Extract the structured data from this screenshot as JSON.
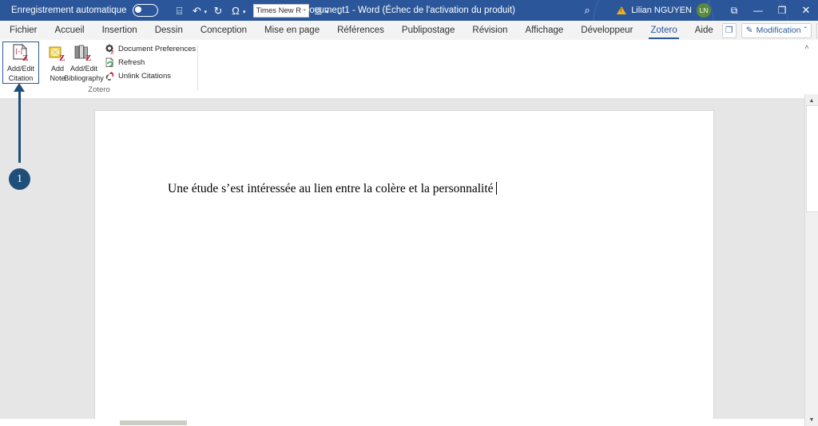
{
  "titlebar": {
    "autosave_label": "Enregistrement automatique",
    "autosave_state": "off",
    "document_title": "Document1  -  Word (Échec de l'activation du produit)",
    "user_name": "Lilian NGUYEN",
    "user_initials": "LN",
    "accent_color": "#2b579a",
    "quick_access": [
      {
        "name": "save-icon",
        "glyph": "⌸"
      },
      {
        "name": "undo-icon",
        "glyph": "↶"
      },
      {
        "name": "redo-icon",
        "glyph": "↻"
      },
      {
        "name": "symbol-omega-icon",
        "glyph": "Ω"
      }
    ],
    "font_name_box": "Times New R",
    "list_icon": "≣",
    "qat_customize_icon": "⌄",
    "search_icon": "⌕",
    "warning_icon": "warning-triangle",
    "ribbon_display_icon": "⧉",
    "minimize_icon": "—",
    "restore_icon": "❐",
    "close_icon": "✕"
  },
  "tabs": [
    {
      "label": "Fichier",
      "active": false
    },
    {
      "label": "Accueil",
      "active": false
    },
    {
      "label": "Insertion",
      "active": false
    },
    {
      "label": "Dessin",
      "active": false
    },
    {
      "label": "Conception",
      "active": false
    },
    {
      "label": "Mise en page",
      "active": false
    },
    {
      "label": "Références",
      "active": false
    },
    {
      "label": "Publipostage",
      "active": false
    },
    {
      "label": "Révision",
      "active": false
    },
    {
      "label": "Affichage",
      "active": false
    },
    {
      "label": "Développeur",
      "active": false
    },
    {
      "label": "Zotero",
      "active": true
    },
    {
      "label": "Aide",
      "active": false
    }
  ],
  "tabbar_right": {
    "comments_icon": "❐",
    "editing_label": "Modification",
    "editing_caret": "ˇ",
    "share_icon": "⇧",
    "share_caret": "ˇ"
  },
  "ribbon": {
    "group_label": "Zotero",
    "collapse_icon": "˄",
    "big_buttons": [
      {
        "name": "add-edit-citation-button",
        "line1": "Add/Edit",
        "line2": "Citation",
        "selected": true
      },
      {
        "name": "add-note-button",
        "line1": "Add",
        "line2": "Note",
        "selected": false
      },
      {
        "name": "add-edit-bibliography-button",
        "line1": "Add/Edit",
        "line2": "Bibliography",
        "selected": false
      }
    ],
    "small_commands": [
      {
        "name": "document-preferences-command",
        "label": "Document Preferences"
      },
      {
        "name": "refresh-command",
        "label": "Refresh"
      },
      {
        "name": "unlink-citations-command",
        "label": "Unlink Citations"
      }
    ]
  },
  "document": {
    "body_text": "Une étude s’est intéressée au lien entre la colère et la personnalité"
  },
  "annotation": {
    "step_number": "1",
    "color": "#1f4e79"
  },
  "scrollbars": {
    "v_up_icon": "▲",
    "v_down_icon": "▼"
  }
}
